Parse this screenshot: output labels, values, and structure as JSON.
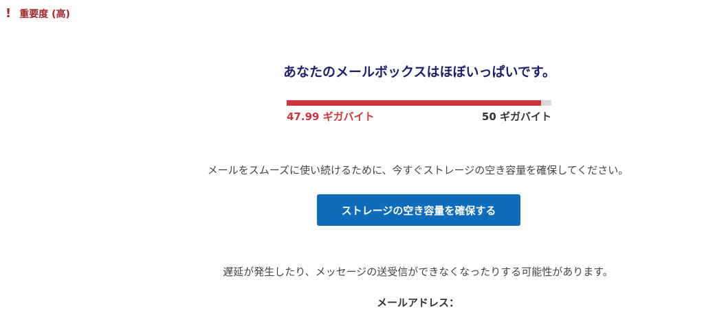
{
  "importance": {
    "icon": "exclamation-icon",
    "label": "重要度 (高)",
    "color": "#a4262c"
  },
  "headline": "あなたのメールボックスはほぼいっぱいです。",
  "quota": {
    "used_label": "47.99 ギガバイト",
    "total_label": "50 ギガバイト",
    "used_fraction": 0.9598,
    "fill_color": "#d13438"
  },
  "message": "メールをスムーズに使い続けるために、今すぐストレージの空き容量を確保してください。",
  "cta": {
    "label": "ストレージの空き容量を確保する",
    "color": "#0f6cbd"
  },
  "warning": "遅延が発生したり、メッセージの送受信ができなくなったりする可能性があります。",
  "email_label": "メールアドレス："
}
